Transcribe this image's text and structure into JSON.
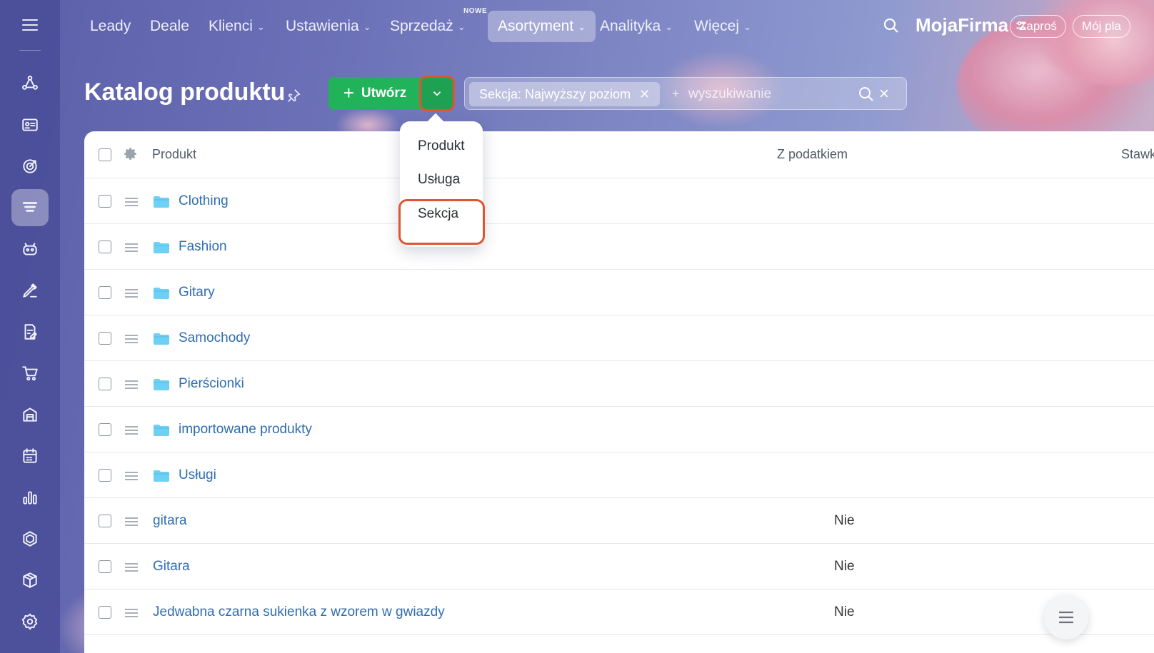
{
  "topnav": {
    "items": [
      {
        "label": "Leady",
        "dropdown": false
      },
      {
        "label": "Deale",
        "dropdown": false
      },
      {
        "label": "Klienci",
        "dropdown": true
      },
      {
        "label": "Ustawienia",
        "dropdown": true
      },
      {
        "label": "Sprzedaż",
        "dropdown": true,
        "badge": "NOWE"
      },
      {
        "label": "Asortyment",
        "dropdown": true,
        "active": true
      },
      {
        "label": "Analityka",
        "dropdown": true
      },
      {
        "label": "Więcej",
        "dropdown": true
      }
    ],
    "new_badge": "NOWE",
    "brand": "MojaFirma",
    "invite_label": "Zaproś",
    "plan_label": "Mój pla"
  },
  "page": {
    "title": "Katalog produktu",
    "create_label": "Utwórz"
  },
  "filter": {
    "chip_label": "Sekcja: Najwyższy poziom",
    "search_placeholder": "wyszukiwanie"
  },
  "table": {
    "columns": [
      "Produkt",
      "Z podatkiem",
      "Stawk"
    ],
    "rows": [
      {
        "name": "Clothing",
        "folder": true,
        "tax": ""
      },
      {
        "name": "Fashion",
        "folder": true,
        "tax": ""
      },
      {
        "name": "Gitary",
        "folder": true,
        "tax": ""
      },
      {
        "name": "Samochody",
        "folder": true,
        "tax": ""
      },
      {
        "name": "Pierścionki",
        "folder": true,
        "tax": ""
      },
      {
        "name": "importowane produkty",
        "folder": true,
        "tax": ""
      },
      {
        "name": "Usługi",
        "folder": true,
        "tax": ""
      },
      {
        "name": "gitara",
        "folder": false,
        "tax": "Nie"
      },
      {
        "name": "Gitara",
        "folder": false,
        "tax": "Nie"
      },
      {
        "name": "Jedwabna czarna sukienka z wzorem w gwiazdy",
        "folder": false,
        "tax": "Nie"
      }
    ]
  },
  "create_menu": {
    "items": [
      "Produkt",
      "Usługa",
      "Sekcja"
    ],
    "highlighted": "Sekcja"
  },
  "colors": {
    "create_button": "#21b35a",
    "highlight": "#e0552f",
    "link": "#2e6db0",
    "folder": "#6fd0f5"
  },
  "sidebar_icons": [
    "menu-icon",
    "crm-icon",
    "contact-card-icon",
    "target-icon",
    "catalog-icon",
    "robot-icon",
    "sign-icon",
    "document-icon",
    "cart-icon",
    "warehouse-icon",
    "calendar-icon",
    "analytics-icon",
    "hexagon-icon",
    "box-icon",
    "settings-icon"
  ]
}
